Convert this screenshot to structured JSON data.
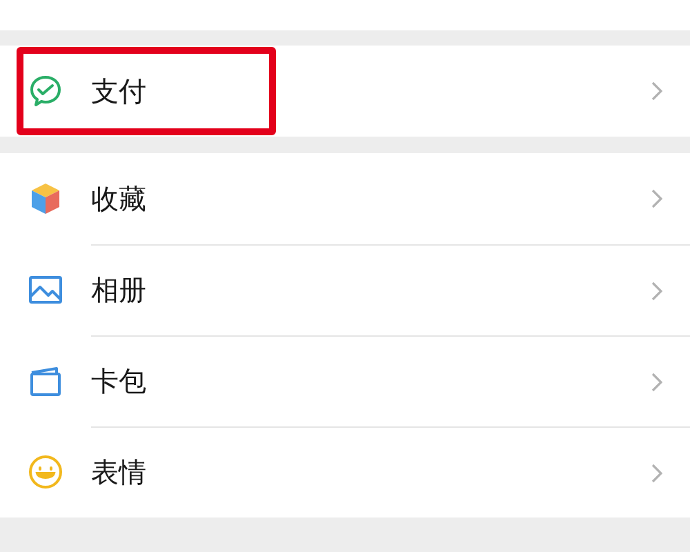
{
  "sections": [
    {
      "items": [
        {
          "label": "支付",
          "highlighted": true
        }
      ]
    },
    {
      "items": [
        {
          "label": "收藏",
          "highlighted": false
        },
        {
          "label": "相册",
          "highlighted": false
        },
        {
          "label": "卡包",
          "highlighted": false
        },
        {
          "label": "表情",
          "highlighted": false
        }
      ]
    }
  ]
}
